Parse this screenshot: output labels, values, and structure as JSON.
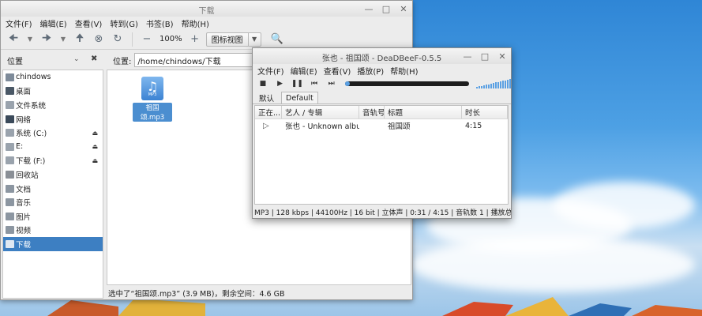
{
  "file_manager": {
    "title": "下载",
    "menu": [
      "文件(F)",
      "编辑(E)",
      "查看(V)",
      "转到(G)",
      "书签(B)",
      "帮助(H)"
    ],
    "zoom": "100%",
    "view_mode": "图标视图",
    "sidebar_label": "位置",
    "location_label": "位置:",
    "location_path": "/home/chindows/下载",
    "places": [
      {
        "label": "chindows",
        "icon": "home-icon",
        "eject": false
      },
      {
        "label": "桌面",
        "icon": "desktop-icon",
        "eject": false
      },
      {
        "label": "文件系统",
        "icon": "drive-icon",
        "eject": false
      },
      {
        "label": "网络",
        "icon": "network-icon",
        "eject": false
      },
      {
        "label": "系统 (C:)",
        "icon": "drive-icon",
        "eject": true
      },
      {
        "label": "E:",
        "icon": "drive-icon",
        "eject": true
      },
      {
        "label": "下载 (F:)",
        "icon": "drive-icon",
        "eject": true
      },
      {
        "label": "回收站",
        "icon": "trash-icon",
        "eject": false
      },
      {
        "label": "文档",
        "icon": "documents-icon",
        "eject": false
      },
      {
        "label": "音乐",
        "icon": "music-icon",
        "eject": false
      },
      {
        "label": "图片",
        "icon": "pictures-icon",
        "eject": false
      },
      {
        "label": "视频",
        "icon": "videos-icon",
        "eject": false
      },
      {
        "label": "下载",
        "icon": "downloads-icon",
        "eject": false
      }
    ],
    "selected_place": 12,
    "file": {
      "name": "祖国颂.mp3",
      "badge": "MP3"
    },
    "status": "选中了“祖国颂.mp3” (3.9 MB)，剩余空间：4.6 GB"
  },
  "player": {
    "title": "张也 - 祖国颂 - DeaDBeeF-0.5.5",
    "menu": [
      "文件(F)",
      "编辑(E)",
      "查看(V)",
      "播放(P)",
      "帮助(H)"
    ],
    "seek_progress": 0.04,
    "volume_level": 1.0,
    "tabs": [
      "默认",
      "Default"
    ],
    "active_tab": 1,
    "columns": [
      "正在...",
      "艺人 / 专辑",
      "音轨号",
      "标题",
      "时长"
    ],
    "tracks": [
      {
        "artist_album": "张也 - Unknown album",
        "track": "",
        "title": "祖国颂",
        "duration": "4:15"
      }
    ],
    "status": "MP3 |  128 kbps | 44100Hz | 16 bit | 立体声 | 0:31 / 4:15 | 音轨数 1 | 播放总时..."
  }
}
